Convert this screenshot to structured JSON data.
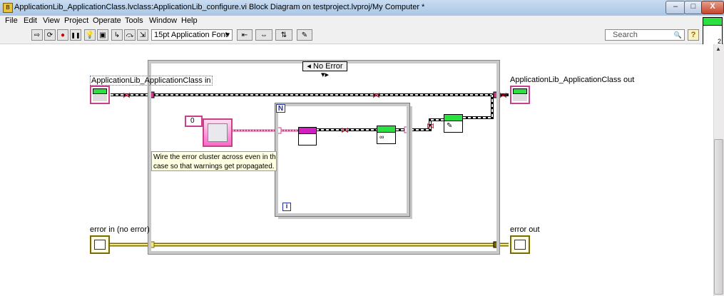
{
  "window": {
    "title": "ApplicationLib_ApplicationClass.lvclass:ApplicationLib_configure.vi Block Diagram on testproject.lvproj/My Computer *",
    "icon_glyph": "B",
    "min_glyph": "–",
    "max_glyph": "□",
    "close_glyph": "X"
  },
  "menubar": {
    "items": [
      "File",
      "Edit",
      "View",
      "Project",
      "Operate",
      "Tools",
      "Window",
      "Help"
    ]
  },
  "toolbar": {
    "font_select": "15pt Application Font",
    "font_select_arrow": "▾",
    "search_placeholder": "Search",
    "search_icon_glyph": "🔍",
    "help_glyph": "?",
    "buttons": [
      {
        "name": "run-arrow-icon",
        "glyph": "⇨"
      },
      {
        "name": "run-continuous-icon",
        "glyph": "⟳"
      },
      {
        "name": "abort-icon",
        "glyph": "●"
      },
      {
        "name": "pause-icon",
        "glyph": "❚❚"
      },
      {
        "name": "highlight-execution-icon",
        "glyph": "💡"
      },
      {
        "name": "retain-wire-values-icon",
        "glyph": "▣"
      },
      {
        "name": "step-into-icon",
        "glyph": "↳"
      },
      {
        "name": "step-over-icon",
        "glyph": "⤼"
      },
      {
        "name": "step-out-icon",
        "glyph": "⇲"
      },
      {
        "name": "align-objects-icon",
        "glyph": "⇤"
      },
      {
        "name": "distribute-objects-icon",
        "glyph": "⇔"
      },
      {
        "name": "reorder-icon",
        "glyph": "⇅"
      },
      {
        "name": "cleanup-diagram-icon",
        "glyph": "✎"
      }
    ]
  },
  "connector_pane_glyph": "2",
  "diagram": {
    "class_in_label": "ApplicationLib_ApplicationClass in",
    "class_out_label": "ApplicationLib_ApplicationClass out",
    "error_in_label": "error in (no error)",
    "error_out_label": "error out",
    "case_selector": "No Error",
    "case_prev": "◂",
    "case_next": "▾▸",
    "loop_count_terminal": "N",
    "loop_iteration_terminal": "i",
    "numeric_constant": "0",
    "comment_line1": "Wire the error cluster across even in the \"",
    "comment_line2": "case so that warnings get propagated."
  }
}
